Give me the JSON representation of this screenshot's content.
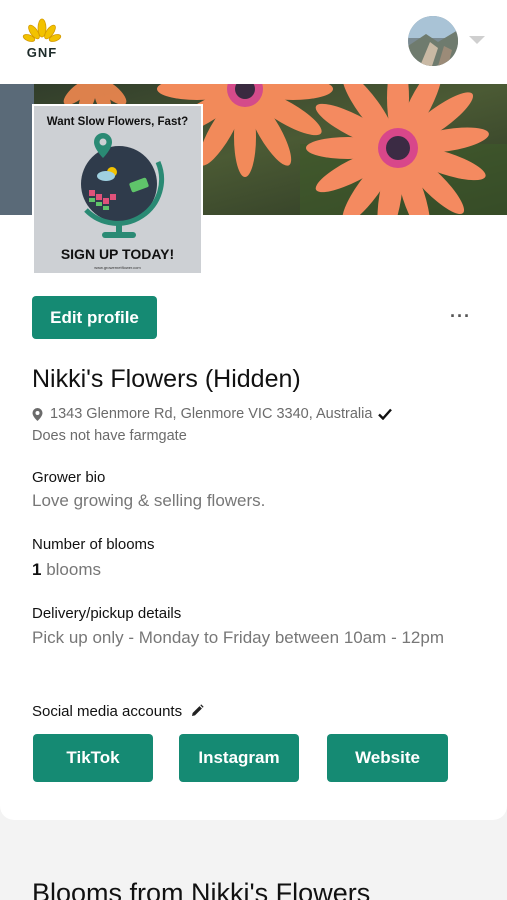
{
  "header": {
    "logo_text": "GNF",
    "avatar_icon": "user-avatar",
    "menu_icon": "caret-down-icon"
  },
  "promo": {
    "headline": "Want Slow Flowers, Fast?",
    "cta": "SIGN UP TODAY!",
    "url": "www.growernetflower.com"
  },
  "profile": {
    "edit_label": "Edit profile",
    "more_label": "···",
    "name": "Nikki's Flowers (Hidden)",
    "address": "1343 Glenmore Rd, Glenmore VIC 3340, Australia",
    "farmgate": "Does not have farmgate"
  },
  "details": {
    "bio_label": "Grower bio",
    "bio_value": "Love growing & selling flowers.",
    "blooms_label": "Number of blooms",
    "blooms_count": "1",
    "blooms_unit": "blooms",
    "delivery_label": "Delivery/pickup details",
    "delivery_value": "Pick up only - Monday to Friday between 10am - 12pm"
  },
  "social": {
    "label": "Social media accounts",
    "buttons": [
      "TikTok",
      "Instagram",
      "Website"
    ]
  },
  "section": {
    "title": "Blooms from Nikki's Flowers"
  },
  "colors": {
    "accent": "#158a73",
    "page_bg": "#f3f3f3",
    "muted_text": "#777777"
  }
}
